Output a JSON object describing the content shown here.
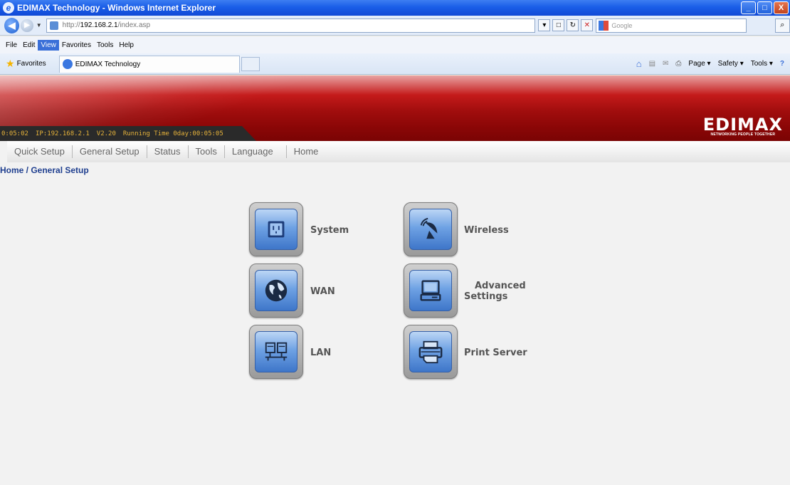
{
  "window": {
    "title": "EDIMAX Technology - Windows Internet Explorer",
    "buttons": [
      "_",
      "□",
      "X"
    ]
  },
  "address_bar": {
    "url_scheme": "http://",
    "url_host": "192.168.2.1",
    "url_path": "/index.asp",
    "search_placeholder": "Google"
  },
  "menu": {
    "items": [
      "File",
      "Edit",
      "View",
      "Favorites",
      "Tools",
      "Help"
    ],
    "active": "View"
  },
  "favorites_bar": {
    "favorites_label": "Favorites",
    "tab_title": "EDIMAX Technology",
    "commands": [
      "Page ▾",
      "Safety ▾",
      "Tools ▾"
    ]
  },
  "banner": {
    "status_clock": "0:05:02",
    "status_ip": "IP:192.168.2.1",
    "status_version": "V2.20",
    "status_running": "Running Time 0day:00:05:05",
    "logo_text": "EDIMAX",
    "logo_tagline": "NETWORKING PEOPLE TOGETHER"
  },
  "nav": {
    "items": [
      "Quick Setup",
      "General Setup",
      "Status",
      "Tools",
      "Language",
      "Home"
    ]
  },
  "breadcrumb": "Home / General Setup",
  "tiles": {
    "system": "System",
    "wireless": "Wireless",
    "wan": "WAN",
    "advanced_line1": "Advanced",
    "advanced_line2": "Settings",
    "lan": "LAN",
    "print_server": "Print Server"
  }
}
